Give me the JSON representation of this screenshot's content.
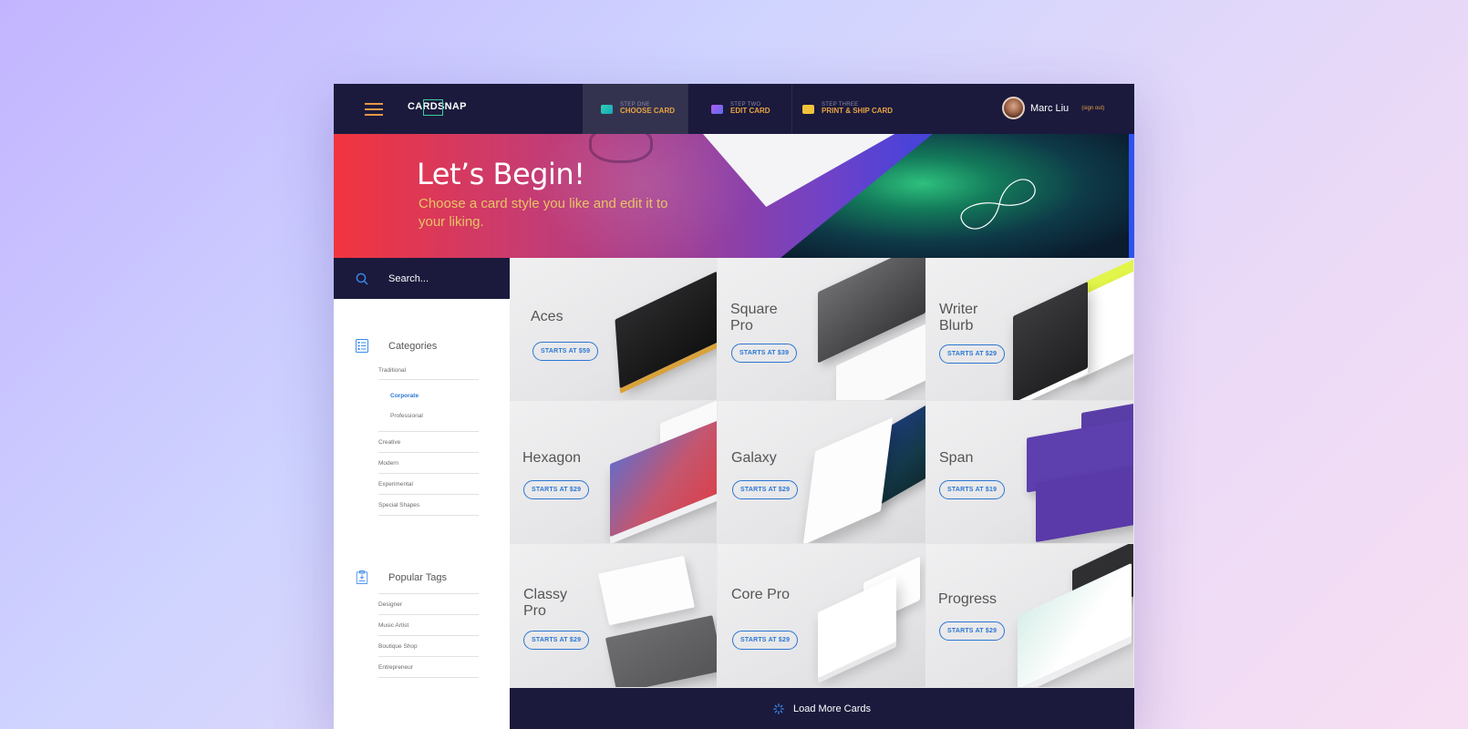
{
  "brand": {
    "logo_text": "CARDSNAP"
  },
  "steps": [
    {
      "small": "STEP ONE",
      "label": "CHOOSE CARD",
      "icon": "card-icon",
      "color": "#2fd1b3"
    },
    {
      "small": "STEP TWO",
      "label": "EDIT CARD",
      "icon": "edit-card-icon",
      "color": "#8a5cf0"
    },
    {
      "small": "STEP THREE",
      "label": "PRINT & SHIP CARD",
      "icon": "truck-icon",
      "color": "#f4c23a"
    }
  ],
  "user": {
    "name": "Marc Liu",
    "signout": "(sign out)"
  },
  "hero": {
    "title": "Let’s Begin!",
    "subtitle": "Choose a card style you like and edit it to your liking."
  },
  "search": {
    "placeholder": "Search..."
  },
  "categories": {
    "title": "Categories",
    "items": [
      "Traditional",
      "Corporate",
      "Professional",
      "Creative",
      "Modern",
      "Experimental",
      "Special Shapes"
    ],
    "active": "Corporate"
  },
  "tags": {
    "title": "Popular Tags",
    "items": [
      "Designer",
      "Music Artist",
      "Boutique Shop",
      "Entrepreneur"
    ]
  },
  "cards": [
    {
      "name": "Aces",
      "price": "STARTS AT $59"
    },
    {
      "name": "Square Pro",
      "price": "STARTS AT $39"
    },
    {
      "name": "Writer Blurb",
      "price": "STARTS AT $29"
    },
    {
      "name": "Hexagon",
      "price": "STARTS AT $29"
    },
    {
      "name": "Galaxy",
      "price": "STARTS AT $29"
    },
    {
      "name": "Span",
      "price": "STARTS AT $19"
    },
    {
      "name": "Classy Pro",
      "price": "STARTS AT $29"
    },
    {
      "name": "Core Pro",
      "price": "STARTS AT $29"
    },
    {
      "name": "Progress",
      "price": "STARTS AT $29"
    }
  ],
  "load_more": "Load More Cards",
  "colors": {
    "navy": "#1b1a3d",
    "accent_orange": "#e8a442",
    "accent_blue": "#2b76d2"
  }
}
